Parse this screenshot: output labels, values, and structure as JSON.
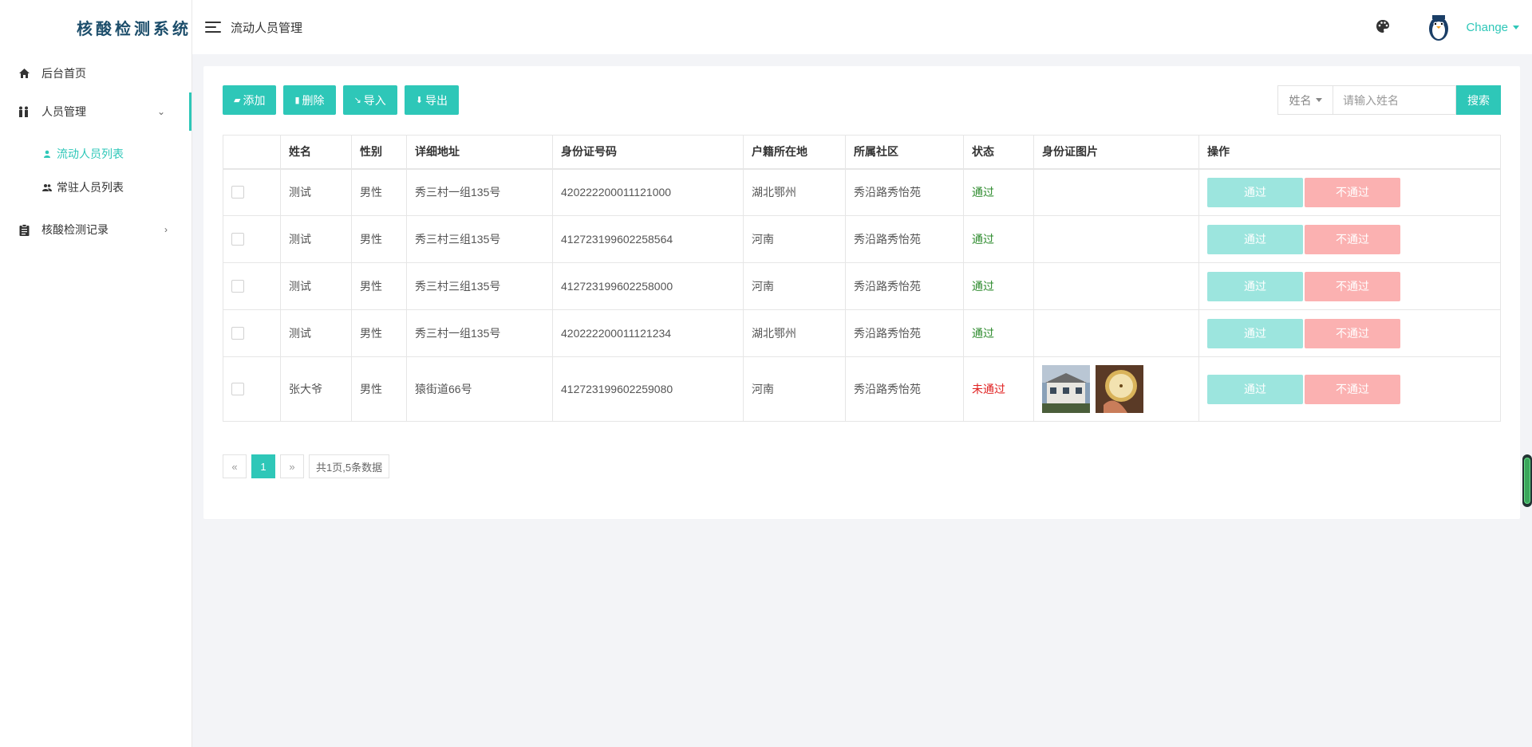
{
  "brand": {
    "title": "核酸检测系统"
  },
  "sidebar": {
    "items": [
      {
        "label": "后台首页"
      },
      {
        "label": "人员管理",
        "sub": [
          {
            "label": "流动人员列表"
          },
          {
            "label": "常驻人员列表"
          }
        ]
      },
      {
        "label": "核酸检测记录"
      }
    ]
  },
  "header": {
    "page_title": "流动人员管理",
    "user": "Change"
  },
  "toolbar": {
    "add": "添加",
    "delete": "删除",
    "import": "导入",
    "export": "导出"
  },
  "search": {
    "field": "姓名",
    "placeholder": "请输入姓名",
    "button": "搜索"
  },
  "table": {
    "headers": [
      "姓名",
      "性别",
      "详细地址",
      "身份证号码",
      "户籍所在地",
      "所属社区",
      "状态",
      "身份证图片",
      "操作"
    ],
    "rows": [
      {
        "name": "测试",
        "gender": "男性",
        "address": "秀三村一组135号",
        "id_no": "420222200011121000",
        "hometown": "湖北鄂州",
        "community": "秀沿路秀怡苑",
        "status": "通过",
        "pass": "通过",
        "reject": "不通过"
      },
      {
        "name": "测试",
        "gender": "男性",
        "address": "秀三村三组135号",
        "id_no": "412723199602258564",
        "hometown": "河南",
        "community": "秀沿路秀怡苑",
        "status": "通过",
        "pass": "通过",
        "reject": "不通过"
      },
      {
        "name": "测试",
        "gender": "男性",
        "address": "秀三村三组135号",
        "id_no": "412723199602258000",
        "hometown": "河南",
        "community": "秀沿路秀怡苑",
        "status": "通过",
        "pass": "通过",
        "reject": "不通过"
      },
      {
        "name": "测试",
        "gender": "男性",
        "address": "秀三村一组135号",
        "id_no": "420222200011121234",
        "hometown": "湖北鄂州",
        "community": "秀沿路秀怡苑",
        "status": "通过",
        "pass": "通过",
        "reject": "不通过"
      },
      {
        "name": "张大爷",
        "gender": "男性",
        "address": "猿街道66号",
        "id_no": "412723199602259080",
        "hometown": "河南",
        "community": "秀沿路秀怡苑",
        "status": "未通过",
        "pass": "通过",
        "reject": "不通过"
      }
    ]
  },
  "pager": {
    "prev": "«",
    "current": "1",
    "next": "»",
    "info": "共1页,5条数据"
  },
  "colors": {
    "accent": "#2ec7b8",
    "pass_btn": "#9ce5de",
    "reject_btn": "#fbb1b1",
    "status_pass": "#2e8b2e",
    "status_fail": "#e02020"
  }
}
